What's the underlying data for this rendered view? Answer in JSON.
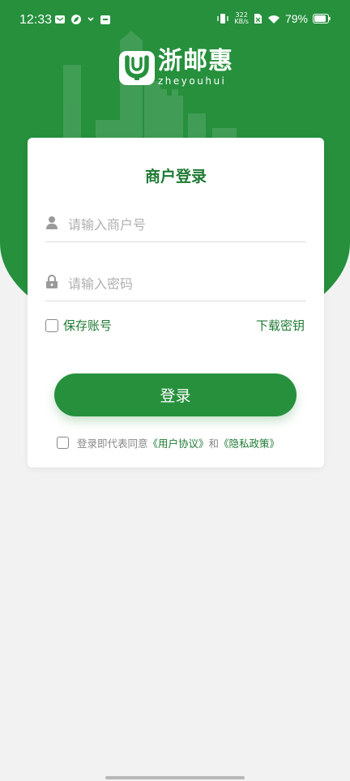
{
  "status_bar": {
    "time": "12:33",
    "net_speed_value": "322",
    "net_speed_unit": "KB/s",
    "battery": "79%"
  },
  "brand": {
    "name": "浙邮惠",
    "pinyin": "zheyouhui",
    "primary_color": "#26903d"
  },
  "login": {
    "title": "商户登录",
    "merchant_placeholder": "请输入商户号",
    "password_placeholder": "请输入密码",
    "save_account": "保存账号",
    "download_key": "下载密钥",
    "login_button": "登录",
    "agree_prefix": "登录即代表同意",
    "user_agreement": "《用户协议》",
    "and": " 和",
    "privacy_policy": "《隐私政策》"
  }
}
